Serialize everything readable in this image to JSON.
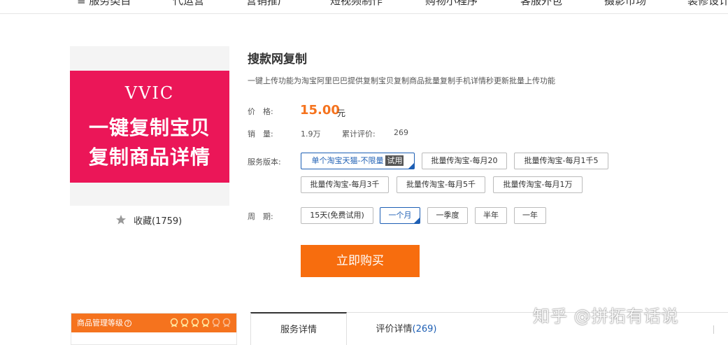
{
  "nav": {
    "items": [
      {
        "label": "≡ 服务类目"
      },
      {
        "label": "代运营"
      },
      {
        "label": "营销推广"
      },
      {
        "label": "短视频制作"
      },
      {
        "label": "购物小程序"
      },
      {
        "label": "客服外包"
      },
      {
        "label": "摄影市场"
      },
      {
        "label": "装修设计"
      }
    ]
  },
  "product": {
    "image": {
      "brand": "VVIC",
      "line1": "一键复制宝贝",
      "line2": "复制商品详情",
      "banner_color": "#eb1658"
    },
    "favorite_label": "收藏(1759)",
    "title": "搜款网复制",
    "description": "一键上传功能为淘宝阿里巴巴提供复制宝贝复制商品批量复制手机详情秒更新批量上传功能",
    "price_label": "价　格:",
    "price": "15.00",
    "price_unit": "元",
    "sales_label": "销　量:",
    "sales": "1.9万",
    "reviews_label": "累计评价:",
    "reviews": "269",
    "version_label": "服务版本:",
    "versions": [
      {
        "label": "单个淘宝天猫-不限量",
        "badge": "试用",
        "selected": true
      },
      {
        "label": "批量传淘宝-每月20"
      },
      {
        "label": "批量传淘宝-每月1千5"
      },
      {
        "label": "批量传淘宝-每月3千"
      },
      {
        "label": "批量传淘宝-每月5千"
      },
      {
        "label": "批量传淘宝-每月1万"
      }
    ],
    "period_label": "周　期:",
    "periods": [
      {
        "label": "15天(免费试用)"
      },
      {
        "label": "一个月",
        "selected": true
      },
      {
        "label": "一季度"
      },
      {
        "label": "半年"
      },
      {
        "label": "一年"
      }
    ],
    "buy_label": "立即购买"
  },
  "grade": {
    "title": "商品管理等级",
    "help": "?",
    "medals_filled": 4,
    "medals_total": 6
  },
  "tabs": [
    {
      "label": "服务详情",
      "active": true
    },
    {
      "label": "评价详情",
      "count": "(269)"
    }
  ],
  "watermark": "知乎 @拼拓有话说",
  "colors": {
    "accent": "#f5731e",
    "selected": "#1e5fb4"
  }
}
